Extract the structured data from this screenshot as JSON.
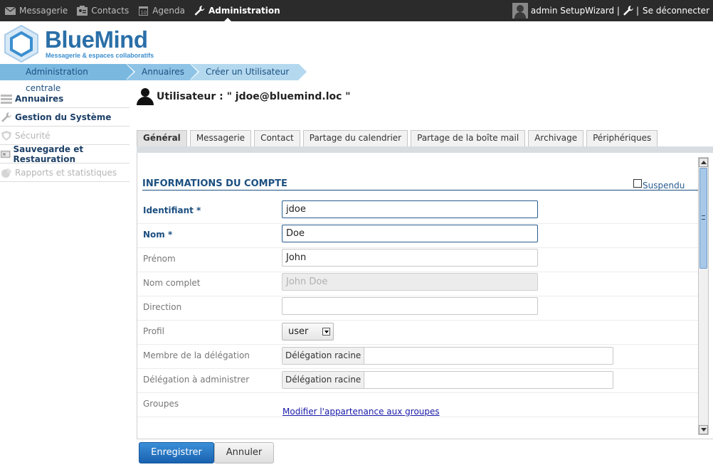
{
  "topbar": {
    "nav": [
      {
        "label": "Messagerie",
        "icon": "mail-icon"
      },
      {
        "label": "Contacts",
        "icon": "contacts-icon"
      },
      {
        "label": "Agenda",
        "icon": "calendar-icon"
      },
      {
        "label": "Administration",
        "icon": "wrench-icon",
        "active": true
      }
    ],
    "user": "admin SetupWizard |",
    "separator": "|",
    "logout": "Se déconnecter"
  },
  "logo": {
    "name": "BlueMind",
    "tagline": "Messagerie & espaces collaboratifs"
  },
  "breadcrumb": [
    "Administration centrale",
    "Annuaires",
    "Créer un Utilisateur"
  ],
  "sidebar": {
    "items": [
      {
        "label": "Annuaires",
        "icon": "directory-icon",
        "enabled": true
      },
      {
        "label": "Gestion du Système",
        "icon": "wrench-icon",
        "enabled": true
      },
      {
        "label": "Sécurité",
        "icon": "shield-icon",
        "enabled": false
      },
      {
        "label": "Sauvegarde et Restauration",
        "icon": "backup-icon",
        "enabled": true
      },
      {
        "label": "Rapports et statistiques",
        "icon": "chart-icon",
        "enabled": false
      }
    ]
  },
  "main": {
    "title": "Utilisateur : \" jdoe@bluemind.loc \"",
    "tabs": [
      "Général",
      "Messagerie",
      "Contact",
      "Partage du calendrier",
      "Partage de la boîte mail",
      "Archivage",
      "Périphériques"
    ],
    "active_tab": "Général",
    "section_title": "INFORMATIONS DU COMPTE",
    "suspend_label": "Suspendu",
    "fields": {
      "identifiant": {
        "label": "Identifiant *",
        "value": "jdoe"
      },
      "nom": {
        "label": "Nom *",
        "value": "Doe"
      },
      "prenom": {
        "label": "Prénom",
        "value": "John"
      },
      "nom_complet": {
        "label": "Nom complet",
        "value": "John Doe"
      },
      "direction": {
        "label": "Direction",
        "value": ""
      },
      "profil": {
        "label": "Profil",
        "value": "user"
      },
      "membre_delegation": {
        "label": "Membre de la délégation",
        "prefix": "Délégation racine",
        "value": ""
      },
      "delegation_admin": {
        "label": "Délégation à administrer",
        "prefix": "Délégation racine",
        "value": ""
      },
      "groupes": {
        "label": "Groupes",
        "link": "Modifier l'appartenance aux groupes"
      }
    }
  },
  "actions": {
    "save": "Enregistrer",
    "cancel": "Annuler"
  },
  "colors": {
    "topbar": "#2b2b2b",
    "brand": "#2a6fa8",
    "section": "#1c4f80",
    "primary_button": "#1a62b0"
  }
}
